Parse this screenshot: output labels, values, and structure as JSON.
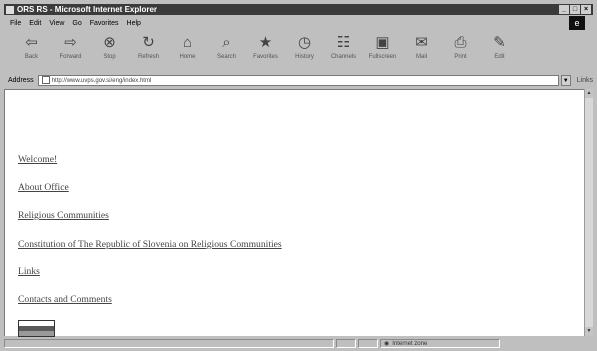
{
  "window": {
    "title": "ORS RS - Microsoft Internet Explorer",
    "min_icon": "_",
    "max_icon": "□",
    "close_icon": "×"
  },
  "menu": [
    "File",
    "Edit",
    "View",
    "Go",
    "Favorites",
    "Help"
  ],
  "toolbar": [
    {
      "label": "Back",
      "icon": "back-arrow",
      "glyph": "⇦"
    },
    {
      "label": "Forward",
      "icon": "forward-arrow",
      "glyph": "⇨"
    },
    {
      "label": "Stop",
      "icon": "stop",
      "glyph": "⊗"
    },
    {
      "label": "Refresh",
      "icon": "refresh",
      "glyph": "↻"
    },
    {
      "label": "Home",
      "icon": "home",
      "glyph": "⌂"
    },
    {
      "label": "Search",
      "icon": "search",
      "glyph": "⌕"
    },
    {
      "label": "Favorites",
      "icon": "favorites",
      "glyph": "★"
    },
    {
      "label": "History",
      "icon": "history",
      "glyph": "◷"
    },
    {
      "label": "Channels",
      "icon": "channels",
      "glyph": "☷"
    },
    {
      "label": "Fullscreen",
      "icon": "fullscreen",
      "glyph": "▣"
    },
    {
      "label": "Mail",
      "icon": "mail",
      "glyph": "✉"
    },
    {
      "label": "Print",
      "icon": "print",
      "glyph": "⎙"
    },
    {
      "label": "Edit",
      "icon": "edit",
      "glyph": "✎"
    }
  ],
  "address": {
    "label": "Address",
    "url": "http://www.uvps.gov.si/eng/index.html",
    "links_label": "Links"
  },
  "nav_links": [
    "Welcome!",
    "About Office",
    "Religious Communities",
    "Constitution of The Republic of Slovenia on Religious Communities",
    "Links",
    "Contacts and Comments"
  ],
  "status": {
    "zone": "Internet zone"
  },
  "colors": {
    "titlebar": "#3b3b3b",
    "chrome": "#bfbfbf",
    "link": "#444444"
  }
}
